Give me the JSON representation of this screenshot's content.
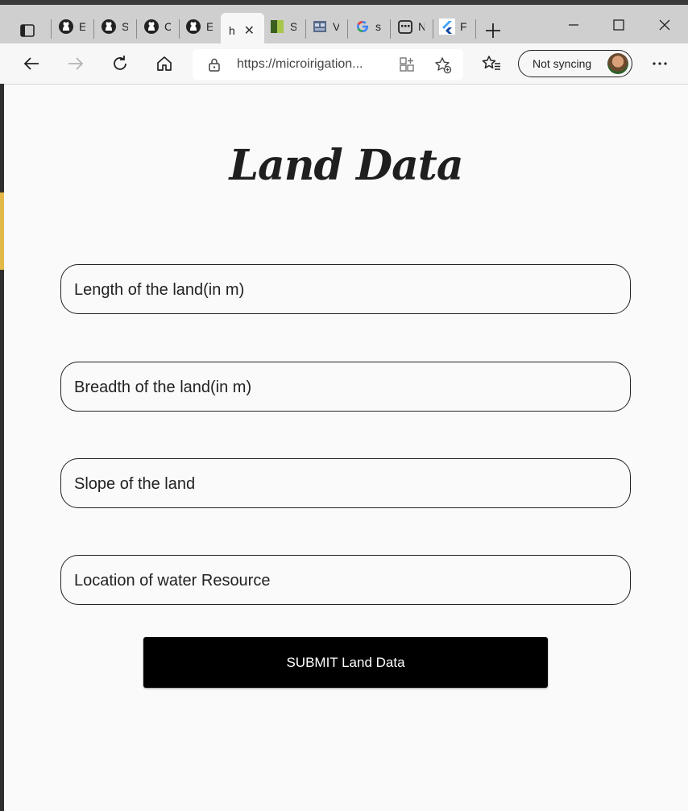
{
  "browser": {
    "tabs": [
      {
        "label": "E",
        "icon": "github-icon"
      },
      {
        "label": "S",
        "icon": "github-icon"
      },
      {
        "label": "C",
        "icon": "github-icon"
      },
      {
        "label": "E",
        "icon": "github-icon"
      },
      {
        "label": "h",
        "icon": "none",
        "active": true
      },
      {
        "label": "S",
        "icon": "green-book-icon"
      },
      {
        "label": "V",
        "icon": "video-icon"
      },
      {
        "label": "s",
        "icon": "google-icon"
      },
      {
        "label": "N",
        "icon": "calendar-icon"
      },
      {
        "label": "F",
        "icon": "flutter-icon"
      }
    ],
    "address": "https://microirigation...",
    "sync_label": "Not syncing"
  },
  "page": {
    "title": "Land Data",
    "fields": [
      {
        "placeholder": "Length of the land(in m)"
      },
      {
        "placeholder": "Breadth of the land(in m)"
      },
      {
        "placeholder": "Slope of the land"
      },
      {
        "placeholder": "Location of water Resource"
      }
    ],
    "submit_label": "SUBMIT Land Data"
  }
}
